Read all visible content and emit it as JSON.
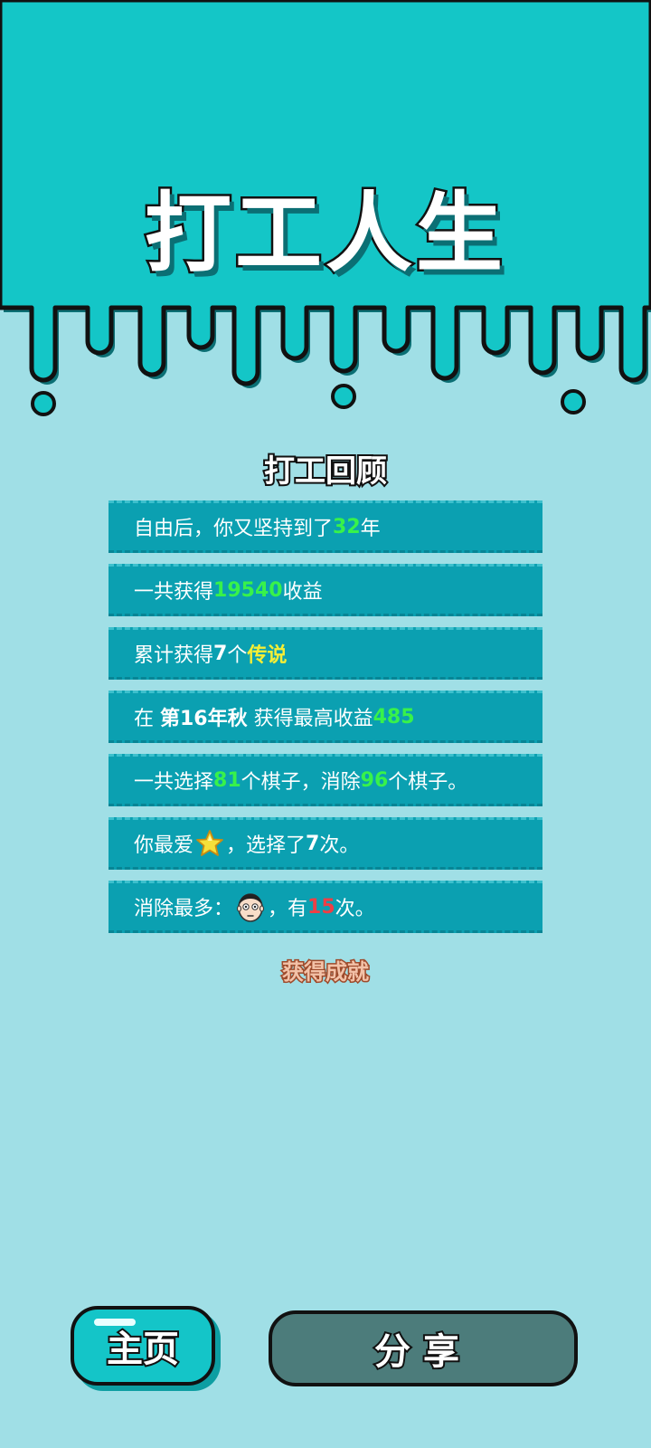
{
  "colors": {
    "header": "#14c6c7",
    "background": "#a0dfe6",
    "row": "#0ba0b1",
    "highlight_green": "#38f24a",
    "highlight_yellow": "#f5ee35",
    "highlight_red": "#ee3f45",
    "home_button": "#14c5c8",
    "share_button": "#4c7c7b"
  },
  "header": {
    "title": "打工人生"
  },
  "review": {
    "title": "打工回顾",
    "rows": [
      {
        "pre": "自由后，你又坚持到了",
        "value": "32",
        "post": "年"
      },
      {
        "pre": "一共获得",
        "value": "19540",
        "post": "收益"
      },
      {
        "pre": "累计获得",
        "count": "7",
        "mid": "个",
        "label": "传说"
      },
      {
        "pre": "在 ",
        "period": "第16年秋",
        "mid": " 获得最高收益",
        "value": "485"
      },
      {
        "pre": "一共选择",
        "value1": "81",
        "mid": "个棋子，消除",
        "value2": "96",
        "post": "个棋子。"
      },
      {
        "pre": "你最爱",
        "icon": "star-icon",
        "mid": "，选择了",
        "count": "7",
        "post": "次。"
      },
      {
        "pre": "消除最多：",
        "icon": "face-icon",
        "mid": "，有",
        "count": "15",
        "post": "次。"
      }
    ]
  },
  "achievements_label": "获得成就",
  "buttons": {
    "home": "主页",
    "share": "分享"
  }
}
